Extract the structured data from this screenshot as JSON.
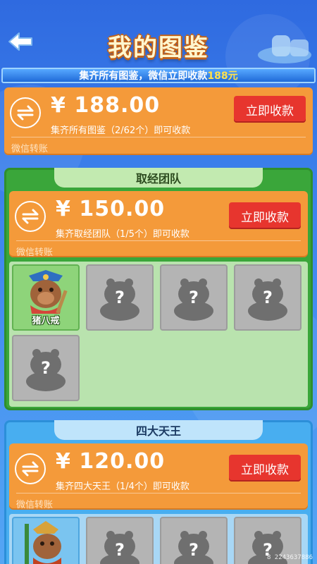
{
  "header": {
    "title": "我的图鉴",
    "back_icon": "back-arrow-icon"
  },
  "banner": {
    "text": "集齐所有图鉴，微信立即收款",
    "amount": "188元"
  },
  "total_reward": {
    "price": "¥ 188.00",
    "desc": "集齐所有图鉴（2/62个）即可收款",
    "wechat": "微信转账",
    "button": "立即收款"
  },
  "teams": [
    {
      "title": "取经团队",
      "price": "¥ 150.00",
      "desc": "集齐取经团队（1/5个）即可收款",
      "wechat": "微信转账",
      "button": "立即收款",
      "cards": [
        {
          "name": "猪八戒",
          "unlocked": true
        },
        {
          "name": "",
          "unlocked": false
        },
        {
          "name": "",
          "unlocked": false
        },
        {
          "name": "",
          "unlocked": false
        },
        {
          "name": "",
          "unlocked": false
        }
      ]
    },
    {
      "title": "四大天王",
      "price": "¥ 120.00",
      "desc": "集齐四大天王（1/4个）即可收款",
      "wechat": "微信转账",
      "button": "立即收款",
      "cards": [
        {
          "name": "",
          "unlocked": true
        },
        {
          "name": "",
          "unlocked": false
        },
        {
          "name": "",
          "unlocked": false
        },
        {
          "name": "",
          "unlocked": false
        }
      ]
    }
  ],
  "locked_mark": "?",
  "watermark": "8 2243637886",
  "colors": {
    "reward_orange": "#f49a3a",
    "button_red": "#e7352e",
    "panel_green": "#3aa63a",
    "panel_blue": "#48aef0",
    "banner_amount": "#ffe14d"
  }
}
